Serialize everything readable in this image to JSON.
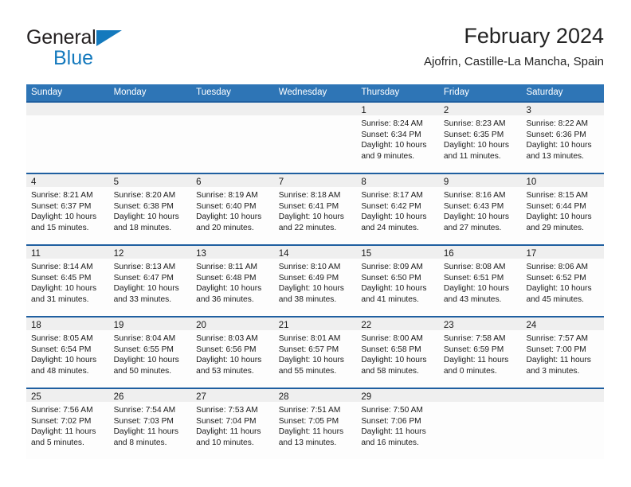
{
  "brand": {
    "name_top": "General",
    "name_bottom": "Blue",
    "triangle_icon": "triangle-icon",
    "accent_color": "#1479bd"
  },
  "header": {
    "title": "February 2024",
    "subtitle": "Ajofrin, Castille-La Mancha, Spain"
  },
  "theme": {
    "header_blue": "#2e75b6",
    "separator_blue": "#1f5fa0",
    "daynum_band": "#efefef",
    "text": "#1a1a1a"
  },
  "weekdays": [
    "Sunday",
    "Monday",
    "Tuesday",
    "Wednesday",
    "Thursday",
    "Friday",
    "Saturday"
  ],
  "weeks": [
    [
      {
        "day": "",
        "sunrise": "",
        "sunset": "",
        "daylight1": "",
        "daylight2": ""
      },
      {
        "day": "",
        "sunrise": "",
        "sunset": "",
        "daylight1": "",
        "daylight2": ""
      },
      {
        "day": "",
        "sunrise": "",
        "sunset": "",
        "daylight1": "",
        "daylight2": ""
      },
      {
        "day": "",
        "sunrise": "",
        "sunset": "",
        "daylight1": "",
        "daylight2": ""
      },
      {
        "day": "1",
        "sunrise": "Sunrise: 8:24 AM",
        "sunset": "Sunset: 6:34 PM",
        "daylight1": "Daylight: 10 hours",
        "daylight2": "and 9 minutes."
      },
      {
        "day": "2",
        "sunrise": "Sunrise: 8:23 AM",
        "sunset": "Sunset: 6:35 PM",
        "daylight1": "Daylight: 10 hours",
        "daylight2": "and 11 minutes."
      },
      {
        "day": "3",
        "sunrise": "Sunrise: 8:22 AM",
        "sunset": "Sunset: 6:36 PM",
        "daylight1": "Daylight: 10 hours",
        "daylight2": "and 13 minutes."
      }
    ],
    [
      {
        "day": "4",
        "sunrise": "Sunrise: 8:21 AM",
        "sunset": "Sunset: 6:37 PM",
        "daylight1": "Daylight: 10 hours",
        "daylight2": "and 15 minutes."
      },
      {
        "day": "5",
        "sunrise": "Sunrise: 8:20 AM",
        "sunset": "Sunset: 6:38 PM",
        "daylight1": "Daylight: 10 hours",
        "daylight2": "and 18 minutes."
      },
      {
        "day": "6",
        "sunrise": "Sunrise: 8:19 AM",
        "sunset": "Sunset: 6:40 PM",
        "daylight1": "Daylight: 10 hours",
        "daylight2": "and 20 minutes."
      },
      {
        "day": "7",
        "sunrise": "Sunrise: 8:18 AM",
        "sunset": "Sunset: 6:41 PM",
        "daylight1": "Daylight: 10 hours",
        "daylight2": "and 22 minutes."
      },
      {
        "day": "8",
        "sunrise": "Sunrise: 8:17 AM",
        "sunset": "Sunset: 6:42 PM",
        "daylight1": "Daylight: 10 hours",
        "daylight2": "and 24 minutes."
      },
      {
        "day": "9",
        "sunrise": "Sunrise: 8:16 AM",
        "sunset": "Sunset: 6:43 PM",
        "daylight1": "Daylight: 10 hours",
        "daylight2": "and 27 minutes."
      },
      {
        "day": "10",
        "sunrise": "Sunrise: 8:15 AM",
        "sunset": "Sunset: 6:44 PM",
        "daylight1": "Daylight: 10 hours",
        "daylight2": "and 29 minutes."
      }
    ],
    [
      {
        "day": "11",
        "sunrise": "Sunrise: 8:14 AM",
        "sunset": "Sunset: 6:45 PM",
        "daylight1": "Daylight: 10 hours",
        "daylight2": "and 31 minutes."
      },
      {
        "day": "12",
        "sunrise": "Sunrise: 8:13 AM",
        "sunset": "Sunset: 6:47 PM",
        "daylight1": "Daylight: 10 hours",
        "daylight2": "and 33 minutes."
      },
      {
        "day": "13",
        "sunrise": "Sunrise: 8:11 AM",
        "sunset": "Sunset: 6:48 PM",
        "daylight1": "Daylight: 10 hours",
        "daylight2": "and 36 minutes."
      },
      {
        "day": "14",
        "sunrise": "Sunrise: 8:10 AM",
        "sunset": "Sunset: 6:49 PM",
        "daylight1": "Daylight: 10 hours",
        "daylight2": "and 38 minutes."
      },
      {
        "day": "15",
        "sunrise": "Sunrise: 8:09 AM",
        "sunset": "Sunset: 6:50 PM",
        "daylight1": "Daylight: 10 hours",
        "daylight2": "and 41 minutes."
      },
      {
        "day": "16",
        "sunrise": "Sunrise: 8:08 AM",
        "sunset": "Sunset: 6:51 PM",
        "daylight1": "Daylight: 10 hours",
        "daylight2": "and 43 minutes."
      },
      {
        "day": "17",
        "sunrise": "Sunrise: 8:06 AM",
        "sunset": "Sunset: 6:52 PM",
        "daylight1": "Daylight: 10 hours",
        "daylight2": "and 45 minutes."
      }
    ],
    [
      {
        "day": "18",
        "sunrise": "Sunrise: 8:05 AM",
        "sunset": "Sunset: 6:54 PM",
        "daylight1": "Daylight: 10 hours",
        "daylight2": "and 48 minutes."
      },
      {
        "day": "19",
        "sunrise": "Sunrise: 8:04 AM",
        "sunset": "Sunset: 6:55 PM",
        "daylight1": "Daylight: 10 hours",
        "daylight2": "and 50 minutes."
      },
      {
        "day": "20",
        "sunrise": "Sunrise: 8:03 AM",
        "sunset": "Sunset: 6:56 PM",
        "daylight1": "Daylight: 10 hours",
        "daylight2": "and 53 minutes."
      },
      {
        "day": "21",
        "sunrise": "Sunrise: 8:01 AM",
        "sunset": "Sunset: 6:57 PM",
        "daylight1": "Daylight: 10 hours",
        "daylight2": "and 55 minutes."
      },
      {
        "day": "22",
        "sunrise": "Sunrise: 8:00 AM",
        "sunset": "Sunset: 6:58 PM",
        "daylight1": "Daylight: 10 hours",
        "daylight2": "and 58 minutes."
      },
      {
        "day": "23",
        "sunrise": "Sunrise: 7:58 AM",
        "sunset": "Sunset: 6:59 PM",
        "daylight1": "Daylight: 11 hours",
        "daylight2": "and 0 minutes."
      },
      {
        "day": "24",
        "sunrise": "Sunrise: 7:57 AM",
        "sunset": "Sunset: 7:00 PM",
        "daylight1": "Daylight: 11 hours",
        "daylight2": "and 3 minutes."
      }
    ],
    [
      {
        "day": "25",
        "sunrise": "Sunrise: 7:56 AM",
        "sunset": "Sunset: 7:02 PM",
        "daylight1": "Daylight: 11 hours",
        "daylight2": "and 5 minutes."
      },
      {
        "day": "26",
        "sunrise": "Sunrise: 7:54 AM",
        "sunset": "Sunset: 7:03 PM",
        "daylight1": "Daylight: 11 hours",
        "daylight2": "and 8 minutes."
      },
      {
        "day": "27",
        "sunrise": "Sunrise: 7:53 AM",
        "sunset": "Sunset: 7:04 PM",
        "daylight1": "Daylight: 11 hours",
        "daylight2": "and 10 minutes."
      },
      {
        "day": "28",
        "sunrise": "Sunrise: 7:51 AM",
        "sunset": "Sunset: 7:05 PM",
        "daylight1": "Daylight: 11 hours",
        "daylight2": "and 13 minutes."
      },
      {
        "day": "29",
        "sunrise": "Sunrise: 7:50 AM",
        "sunset": "Sunset: 7:06 PM",
        "daylight1": "Daylight: 11 hours",
        "daylight2": "and 16 minutes."
      },
      {
        "day": "",
        "sunrise": "",
        "sunset": "",
        "daylight1": "",
        "daylight2": ""
      },
      {
        "day": "",
        "sunrise": "",
        "sunset": "",
        "daylight1": "",
        "daylight2": ""
      }
    ]
  ]
}
